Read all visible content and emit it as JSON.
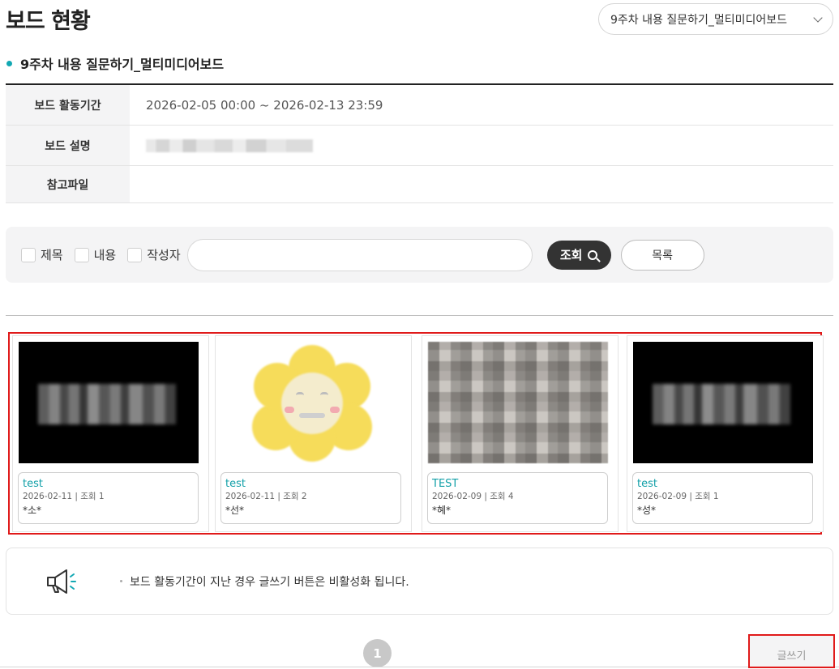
{
  "page": {
    "title": "보드 현황",
    "board_select": "9주차 내용 질문하기_멀티미디어보드"
  },
  "board": {
    "heading": "9주차 내용 질문하기_멀티미디어보드",
    "rows": [
      {
        "label": "보드 활동기간",
        "value": "2026-02-05 00:00 ~ 2026-02-13 23:59"
      },
      {
        "label": "보드 설명",
        "value": ""
      },
      {
        "label": "참고파일",
        "value": ""
      }
    ]
  },
  "search": {
    "filters": [
      "제목",
      "내용",
      "작성자"
    ],
    "input_value": "",
    "search_label": "조회",
    "list_label": "목록"
  },
  "posts": [
    {
      "title": "test",
      "date": "2026-02-11",
      "views": "조회 1",
      "meta": "2026-02-11 | 조회 1",
      "author": "*소*",
      "thumb": "black-logo"
    },
    {
      "title": "test",
      "date": "2026-02-11",
      "views": "조회 2",
      "meta": "2026-02-11 | 조회 2",
      "author": "*선*",
      "thumb": "flower-emoji"
    },
    {
      "title": "TEST",
      "date": "2026-02-09",
      "views": "조회 4",
      "meta": "2026-02-09 | 조회 4",
      "author": "*혜*",
      "thumb": "gray-photo"
    },
    {
      "title": "test",
      "date": "2026-02-09",
      "views": "조회 1",
      "meta": "2026-02-09 | 조회 1",
      "author": "*성*",
      "thumb": "black-logo"
    }
  ],
  "notice": {
    "icon": "megaphone-icon",
    "message": "보드 활동기간이 지난 경우 글쓰기 버튼은 비활성화 됩니다."
  },
  "pagination": {
    "current": "1"
  },
  "write_button": "글쓰기",
  "colors": {
    "accent": "#12a8b3",
    "highlight": "#e01a1a",
    "dark_button": "#333333"
  }
}
